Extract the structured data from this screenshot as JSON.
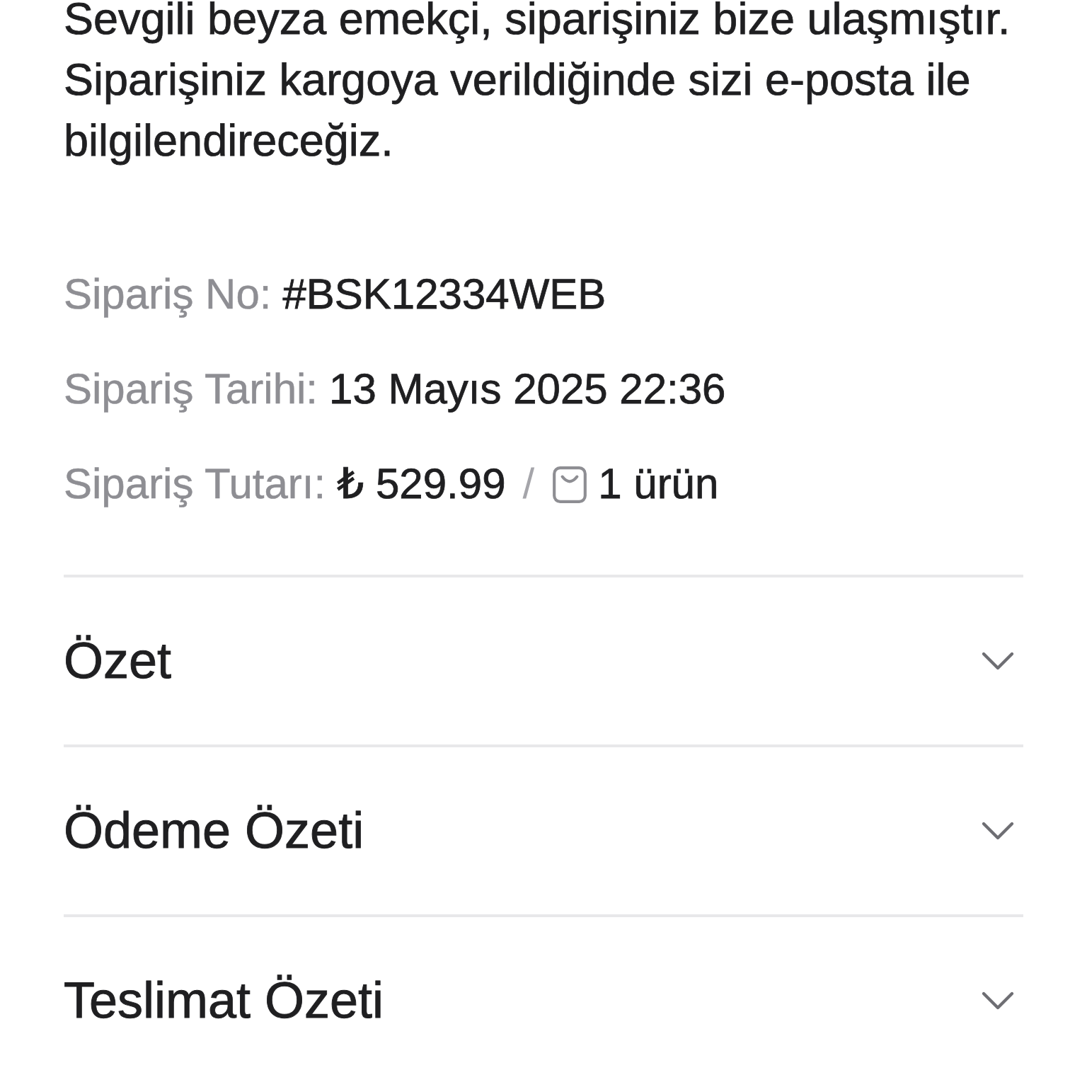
{
  "message": "Sevgili beyza emekçi, siparişiniz bize ulaşmıştır. Siparişiniz kargoya verildiğinde sizi e-posta ile bilgilendireceğiz.",
  "order_info": [
    {
      "label": "Sipariş No:",
      "value": "#BSK12334WEB"
    },
    {
      "label": "Sipariş Tarihi:",
      "value": "13 Mayıs 2025 22:36"
    },
    {
      "label": "Sipariş Tutarı:",
      "value": "₺ 529.99",
      "separator": "/",
      "item_count": "1 ürün"
    }
  ],
  "sections": [
    {
      "title": "Özet",
      "expanded": false
    },
    {
      "title": "Ödeme Özeti",
      "expanded": false
    },
    {
      "title": "Teslimat Özeti",
      "expanded": false
    }
  ]
}
